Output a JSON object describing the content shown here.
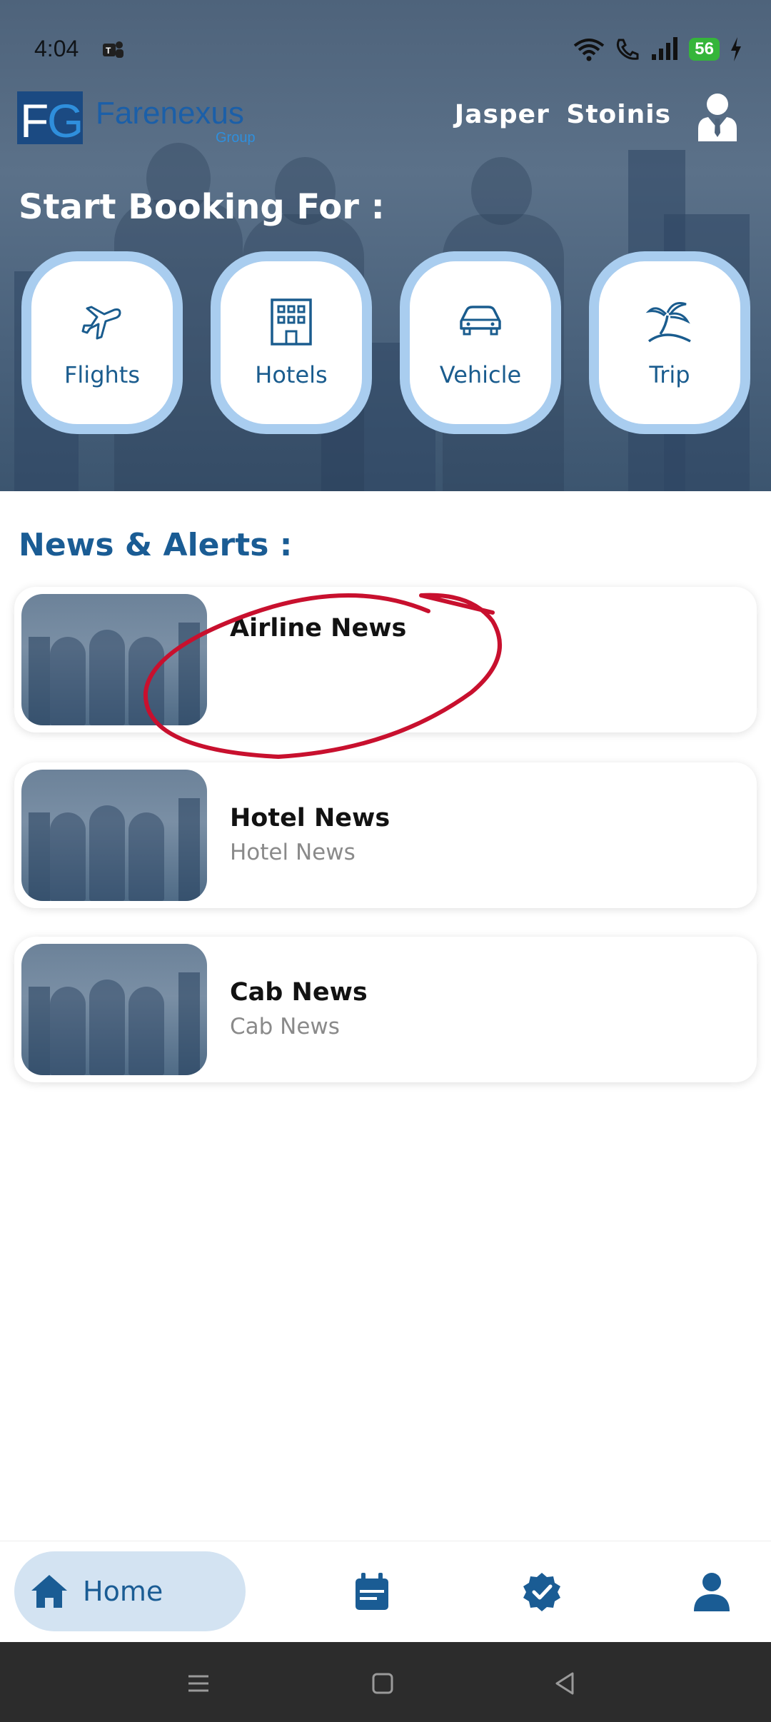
{
  "status_bar": {
    "time": "4:04",
    "battery": "56"
  },
  "header": {
    "brand": "Farenexus",
    "brand_sub": "Group",
    "logo_letters": "FG",
    "user_first": "Jasper",
    "user_last": "Stoinis"
  },
  "booking": {
    "title": "Start Booking For :",
    "tiles": [
      {
        "label": "Flights",
        "icon": "airplane-icon"
      },
      {
        "label": "Hotels",
        "icon": "building-icon"
      },
      {
        "label": "Vehicle",
        "icon": "car-icon"
      },
      {
        "label": "Trip",
        "icon": "palm-tree-icon"
      }
    ]
  },
  "news": {
    "title": "News & Alerts :",
    "items": [
      {
        "title": "Airline News",
        "subtitle": ""
      },
      {
        "title": "Hotel News",
        "subtitle": "Hotel News"
      },
      {
        "title": "Cab News",
        "subtitle": "Cab News"
      }
    ]
  },
  "bottom_nav": {
    "home_label": "Home",
    "items": [
      "home-icon",
      "calendar-icon",
      "verified-badge-icon",
      "profile-icon"
    ]
  },
  "colors": {
    "primary": "#1a5c94",
    "tile_border": "#a9cdef",
    "annotation": "#c8102e",
    "nav_active_bg": "#d3e3f2"
  }
}
